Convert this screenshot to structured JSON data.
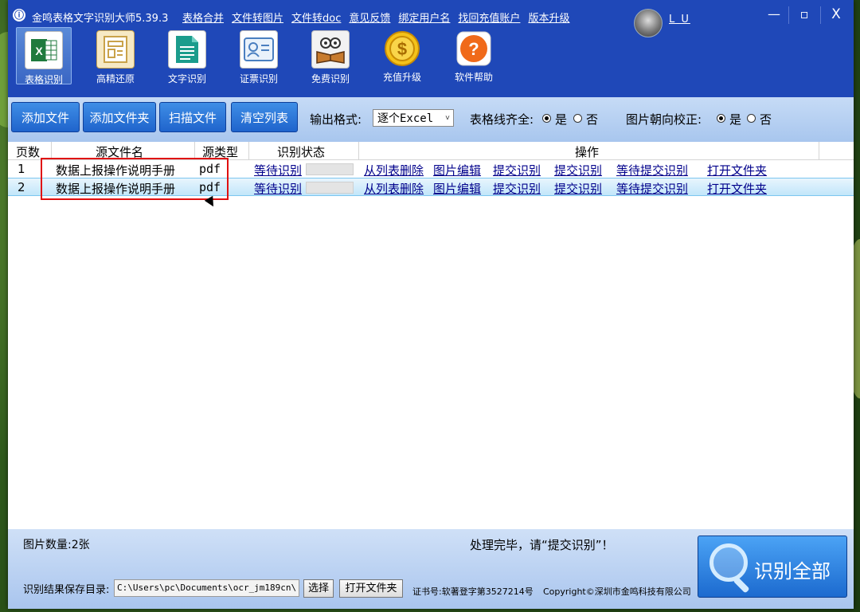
{
  "app": {
    "title": "金鸣表格文字识别大师5.39.3",
    "logo": "ⓘ",
    "username": "L U"
  },
  "top_menu": [
    "表格合并",
    "文件转图片",
    "文件转doc",
    "意见反馈",
    "绑定用户名",
    "找回充值账户",
    "版本升级"
  ],
  "window_controls": {
    "minimize": "—",
    "maximize": "▫",
    "close": "X"
  },
  "toolbar": [
    {
      "label": "表格识别",
      "icon": "excel-icon",
      "active": true
    },
    {
      "label": "高精还原",
      "icon": "document-layout-icon"
    },
    {
      "label": "文字识别",
      "icon": "text-document-icon"
    },
    {
      "label": "证票识别",
      "icon": "id-card-icon"
    },
    {
      "label": "免费识别",
      "icon": "owl-book-icon"
    },
    {
      "label": "充值升级",
      "icon": "coin-icon"
    },
    {
      "label": "软件帮助",
      "icon": "help-icon"
    }
  ],
  "actions": {
    "add_file": "添加文件",
    "add_folder": "添加文件夹",
    "scan_file": "扫描文件",
    "clear_list": "清空列表",
    "output_format_label": "输出格式:",
    "output_format_value": "逐个Excel",
    "table_lines_label": "表格线齐全:",
    "orientation_label": "图片朝向校正:",
    "yes": "是",
    "no": "否"
  },
  "table": {
    "headers": [
      "页数",
      "源文件名",
      "源类型",
      "识别状态",
      "操作"
    ],
    "rows": [
      {
        "page": "1",
        "filename": "数据上报操作说明手册",
        "type": "pdf",
        "status": "等待识别",
        "ops": [
          "从列表删除",
          "图片编辑",
          "提交识别",
          "提交识别",
          "等待提交识别",
          "打开文件夹"
        ]
      },
      {
        "page": "2",
        "filename": "数据上报操作说明手册",
        "type": "pdf",
        "status": "等待识别",
        "ops": [
          "从列表删除",
          "图片编辑",
          "提交识别",
          "提交识别",
          "等待提交识别",
          "打开文件夹"
        ]
      }
    ]
  },
  "status": {
    "image_count": "图片数量:2张",
    "message": "处理完毕，请“提交识别”！",
    "save_dir_label": "识别结果保存目录:",
    "save_dir_value": "C:\\Users\\pc\\Documents\\ocr_jm189cn\\",
    "choose_btn": "选择",
    "open_folder_btn": "打开文件夹",
    "cert": "证书号:软著登字第3527214号",
    "copyright": "Copyright©深圳市金鸣科技有限公司",
    "recognize_all": "识别全部"
  },
  "colors": {
    "window_blue": "#1f48b8",
    "button_blue": "#1f64cc",
    "highlight_red": "#e01010"
  }
}
